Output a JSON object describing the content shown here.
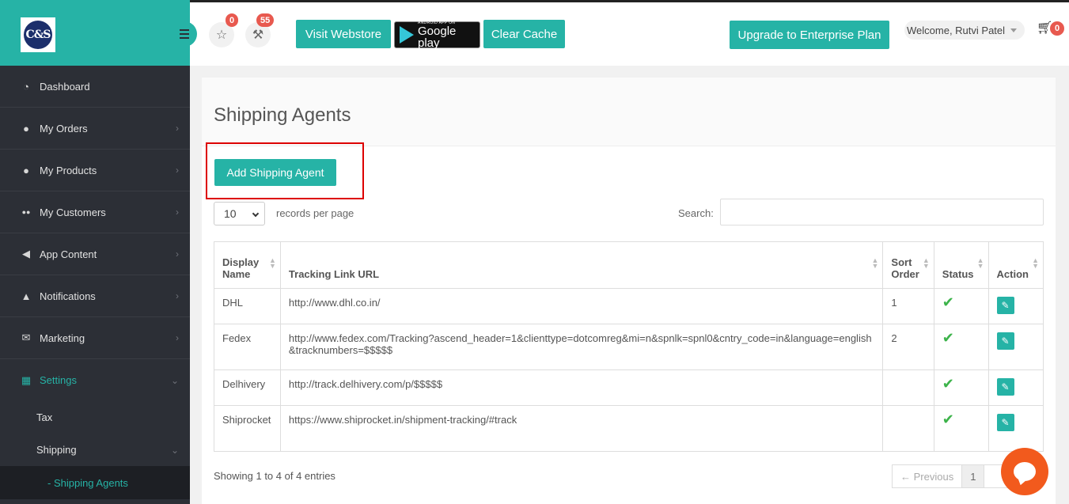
{
  "brand": {
    "logo_text": "C&S"
  },
  "sidebar": {
    "items": [
      {
        "label": "Dashboard",
        "icon": "dashboard-icon",
        "glyph": "◔"
      },
      {
        "label": "My Orders",
        "icon": "user-icon",
        "glyph": "●"
      },
      {
        "label": "My Products",
        "icon": "user-icon",
        "glyph": "●"
      },
      {
        "label": "My Customers",
        "icon": "users-icon",
        "glyph": "●●"
      },
      {
        "label": "App Content",
        "icon": "bullhorn-icon",
        "glyph": "◀"
      },
      {
        "label": "Notifications",
        "icon": "bell-icon",
        "glyph": "▲"
      },
      {
        "label": "Marketing",
        "icon": "envelope-icon",
        "glyph": "✉"
      },
      {
        "label": "Settings",
        "icon": "grid-icon",
        "glyph": "▦"
      }
    ],
    "sub_items": [
      "Tax",
      "Shipping"
    ],
    "sub_sub_item": "- Shipping Agents"
  },
  "topbar": {
    "reviews_count": "0",
    "tools_count": "55",
    "visit_webstore": "Visit Webstore",
    "google_play_small": "ANDROID APP ON",
    "google_play_big": "Google play",
    "clear_cache": "Clear Cache",
    "upgrade": "Upgrade to Enterprise Plan",
    "welcome": "Welcome, Rutvi Patel",
    "cart_count": "0"
  },
  "page": {
    "title": "Shipping Agents",
    "add_button": "Add Shipping Agent",
    "page_length": "10",
    "records_label": "records per page",
    "search_label": "Search:",
    "search_value": ""
  },
  "table": {
    "headers": [
      "Display Name",
      "Tracking Link URL",
      "Sort Order",
      "Status",
      "Action"
    ],
    "rows": [
      {
        "name": "DHL",
        "url": "http://www.dhl.co.in/",
        "sort": "1"
      },
      {
        "name": "Fedex",
        "url": "http://www.fedex.com/Tracking?ascend_header=1&clienttype=dotcomreg&mi=n&spnlk=spnl0&cntry_code=in&language=english&tracknumbers=$$$$$",
        "sort": "2"
      },
      {
        "name": "Delhivery",
        "url": "http://track.delhivery.com/p/$$$$$",
        "sort": ""
      },
      {
        "name": "Shiprocket",
        "url": "https://www.shiprocket.in/shipment-tracking/#track",
        "sort": ""
      }
    ]
  },
  "footer": {
    "info": "Showing 1 to 4 of 4 entries",
    "previous": "← Previous",
    "current_page": "1"
  },
  "colors": {
    "accent": "#26b3a6",
    "sidebar": "#2c2f36",
    "badge": "#e8594f",
    "chat": "#f25a1d"
  }
}
